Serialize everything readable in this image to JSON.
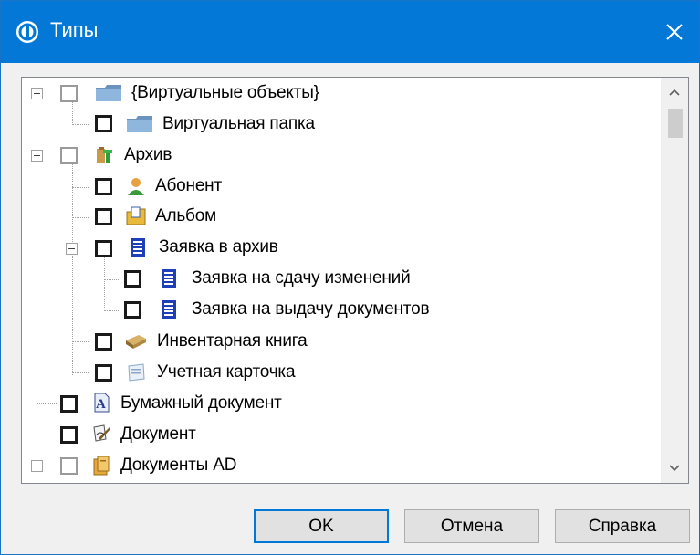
{
  "window": {
    "title": "Типы"
  },
  "tree": {
    "items": [
      {
        "label": "{Виртуальные объекты}",
        "icon": "folder-icon"
      },
      {
        "label": "Виртуальная папка",
        "icon": "folder-icon"
      },
      {
        "label": "Архив",
        "icon": "archive-icon"
      },
      {
        "label": "Абонент",
        "icon": "person-icon"
      },
      {
        "label": "Альбом",
        "icon": "album-folder-icon"
      },
      {
        "label": "Заявка в архив",
        "icon": "request-document-icon"
      },
      {
        "label": "Заявка на сдачу изменений",
        "icon": "request-document-icon"
      },
      {
        "label": "Заявка на выдачу документов",
        "icon": "request-document-icon"
      },
      {
        "label": "Инвентарная книга",
        "icon": "book-icon"
      },
      {
        "label": "Учетная карточка",
        "icon": "card-icon"
      },
      {
        "label": "Бумажный документ",
        "icon": "paper-document-icon"
      },
      {
        "label": "Документ",
        "icon": "document-pen-icon"
      },
      {
        "label": "Документы AD",
        "icon": "ad-documents-icon"
      }
    ]
  },
  "buttons": {
    "ok": "OK",
    "cancel": "Отмена",
    "help": "Справка"
  },
  "colors": {
    "titlebar": "#0478d7",
    "accent": "#0078d7"
  }
}
